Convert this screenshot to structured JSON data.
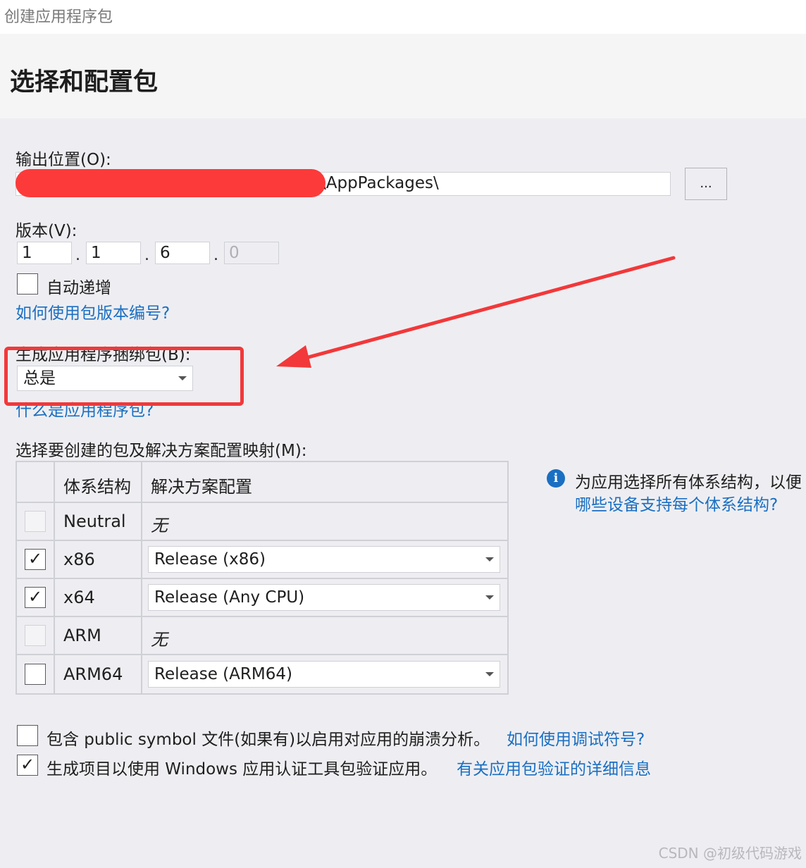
{
  "window": {
    "title": "创建应用程序包"
  },
  "header": {
    "title": "选择和配置包"
  },
  "output": {
    "label": "输出位置(O):",
    "path_suffix": "\\AppPackages\\",
    "browse_label": "..."
  },
  "version": {
    "label": "版本(V):",
    "parts": [
      "1",
      "1",
      "6",
      "0"
    ],
    "separator": ".",
    "auto_increment_label": "自动递增",
    "auto_increment_checked": false,
    "help_link": "如何使用包版本编号?"
  },
  "bundle": {
    "label": "生成应用程序捆绑包(B):",
    "selected": "总是",
    "help_link": "什么是应用程序包?"
  },
  "mapping": {
    "label": "选择要创建的包及解决方案配置映射(M):",
    "columns": [
      "体系结构",
      "解决方案配置"
    ],
    "rows": [
      {
        "arch": "Neutral",
        "config": "无",
        "checked": false,
        "enabled": false,
        "is_dropdown": false
      },
      {
        "arch": "x86",
        "config": "Release (x86)",
        "checked": true,
        "enabled": true,
        "is_dropdown": true
      },
      {
        "arch": "x64",
        "config": "Release (Any CPU)",
        "checked": true,
        "enabled": true,
        "is_dropdown": true
      },
      {
        "arch": "ARM",
        "config": "无",
        "checked": false,
        "enabled": false,
        "is_dropdown": false
      },
      {
        "arch": "ARM64",
        "config": "Release (ARM64)",
        "checked": false,
        "enabled": true,
        "is_dropdown": true
      }
    ],
    "info_text": "为应用选择所有体系结构，以便",
    "info_link": "哪些设备支持每个体系结构?"
  },
  "options": {
    "symbols_text": "包含 public symbol 文件(如果有)以启用对应用的崩溃分析。",
    "symbols_link": "如何使用调试符号?",
    "symbols_checked": false,
    "wack_text": "生成项目以使用 Windows 应用认证工具包验证应用。",
    "wack_link": "有关应用包验证的详细信息",
    "wack_checked": true
  },
  "check_glyph": "✓",
  "info_glyph": "i",
  "watermark": "CSDN @初级代码游戏",
  "colors": {
    "link": "#1a6fc2",
    "annotation": "#f2383a",
    "background": "#eeeef2"
  }
}
